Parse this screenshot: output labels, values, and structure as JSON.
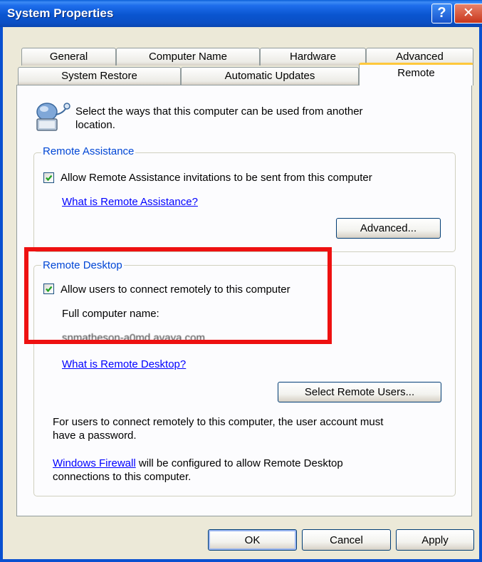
{
  "window": {
    "title": "System Properties",
    "help_label": "?",
    "close_label": "✕"
  },
  "tabs": {
    "row_top": [
      "General",
      "Computer Name",
      "Hardware",
      "Advanced"
    ],
    "row_bottom": [
      "System Restore",
      "Automatic Updates",
      "Remote"
    ],
    "active": "Remote"
  },
  "intro": {
    "line1": "Select the ways that this computer can be used from another",
    "line2": "location."
  },
  "remote_assistance": {
    "label": "Remote Assistance",
    "checkbox_label": "Allow Remote Assistance invitations to be sent from this computer",
    "checked": true,
    "help_link": "What is Remote Assistance?",
    "advanced_button": "Advanced..."
  },
  "remote_desktop": {
    "label": "Remote Desktop",
    "checkbox_label": "Allow users to connect remotely to this computer",
    "checked": true,
    "full_name_label": "Full computer name:",
    "full_name_value": "snmatheson-a0md.avaya.com",
    "help_link": "What is Remote Desktop?",
    "select_users_button": "Select Remote Users...",
    "note_line1": "For users to connect remotely to this computer, the user account must",
    "note_line2": "have a password.",
    "firewall_link": "Windows Firewall",
    "firewall_line1_rest": " will be configured to allow Remote Desktop",
    "firewall_line2": "connections to this computer."
  },
  "footer": {
    "ok": "OK",
    "cancel": "Cancel",
    "apply": "Apply"
  },
  "colors": {
    "titlebar": "#0A55D0",
    "dialog": "#ECE9D8",
    "group_label": "#0046D5",
    "highlight_box": "#EE1111"
  }
}
